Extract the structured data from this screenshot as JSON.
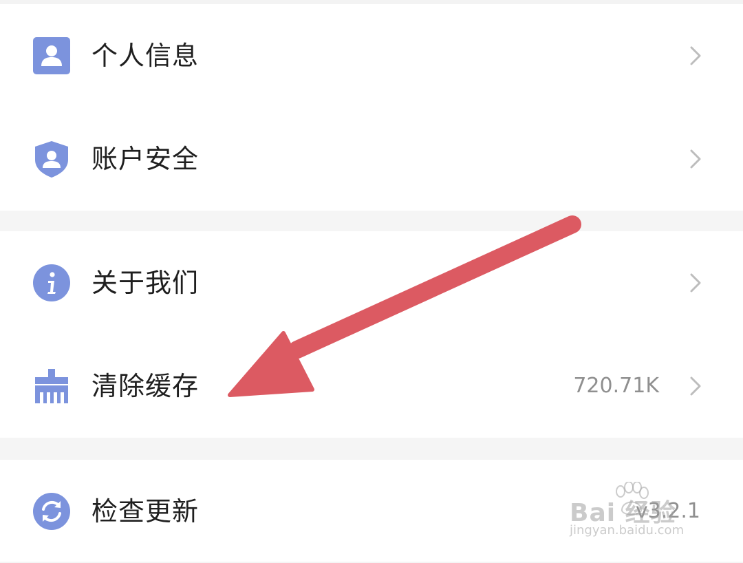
{
  "groups": [
    {
      "items": [
        {
          "label": "个人信息",
          "icon": "person-card-icon",
          "value": ""
        },
        {
          "label": "账户安全",
          "icon": "shield-user-icon",
          "value": ""
        }
      ]
    },
    {
      "items": [
        {
          "label": "关于我们",
          "icon": "info-icon",
          "value": ""
        },
        {
          "label": "清除缓存",
          "icon": "broom-icon",
          "value": "720.71K"
        }
      ]
    },
    {
      "items": [
        {
          "label": "检查更新",
          "icon": "refresh-icon",
          "value": "v3.2.1"
        }
      ]
    }
  ],
  "watermark": {
    "brand": "Bai 经验",
    "url": "jingyan.baidu.com"
  },
  "colors": {
    "icon": "#7c93dd",
    "arrow": "#dc5a62",
    "text": "#1f1f1f",
    "muted": "#8f8f8f",
    "separator": "#f3f3f3"
  }
}
